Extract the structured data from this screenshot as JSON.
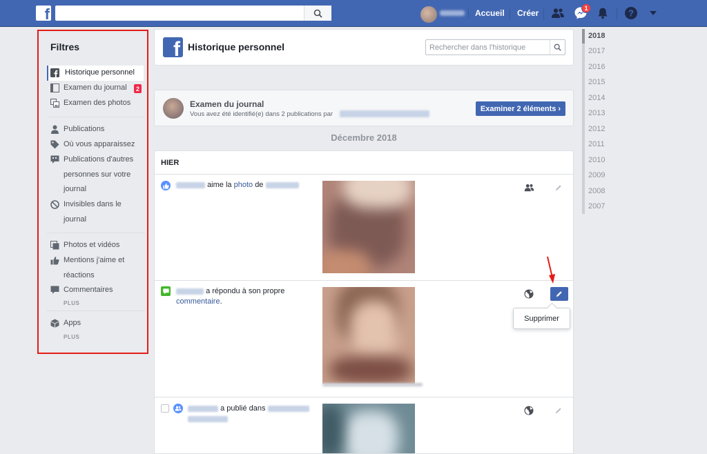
{
  "topbar": {
    "nav": [
      "Accueil",
      "Créer"
    ],
    "messenger_count": "1"
  },
  "filters": {
    "title": "Filtres",
    "items": [
      {
        "label": "Historique personnel",
        "icon": "facebook-square-icon",
        "active": true
      },
      {
        "label": "Examen du journal",
        "icon": "timeline-review-icon",
        "badge": "2"
      },
      {
        "label": "Examen des photos",
        "icon": "photo-review-icon"
      },
      {
        "label": "Publications",
        "icon": "person-icon"
      },
      {
        "label": "Où vous apparaissez",
        "icon": "tag-icon"
      },
      {
        "label": "Publications d'autres personnes sur votre journal",
        "icon": "speech-bubble-icon"
      },
      {
        "label": "Invisibles dans le journal",
        "icon": "hidden-icon"
      },
      {
        "label": "Photos et vidéos",
        "icon": "photos-icon"
      },
      {
        "label": "Mentions j'aime et réactions",
        "icon": "thumbs-up-icon"
      },
      {
        "label": "Commentaires",
        "icon": "comment-icon"
      },
      {
        "label": "Apps",
        "icon": "cube-icon"
      }
    ],
    "lines": {
      "others_1": "Publications d'autres",
      "others_2": "personnes sur votre",
      "others_3": "journal",
      "hidden_1": "Invisibles dans le",
      "hidden_2": "journal",
      "likes_1": "Mentions j'aime et",
      "likes_2": "réactions"
    },
    "more_label": "PLUS"
  },
  "header": {
    "title": "Historique personnel",
    "search_placeholder": "Rechercher dans l'historique"
  },
  "review": {
    "title": "Examen du journal",
    "description": "Vous avez été identifié(e) dans 2 publications par",
    "button": "Examiner 2 éléments ›"
  },
  "month": "Décembre 2018",
  "day": {
    "title": "HIER",
    "activities": [
      {
        "verb": "aime la",
        "link": "photo",
        "suffix": "de",
        "audience": "friends-icon"
      },
      {
        "verb": "a répondu à son propre",
        "link": "commentaire",
        "suffix": ".",
        "audience": "globe-icon"
      },
      {
        "verb": "a publié dans",
        "audience": "globe-icon"
      }
    ],
    "menu_item": "Supprimer"
  },
  "years": [
    "2018",
    "2017",
    "2016",
    "2015",
    "2014",
    "2013",
    "2012",
    "2011",
    "2010",
    "2009",
    "2008",
    "2007"
  ],
  "colors": {
    "brand": "#4267b2",
    "background": "#e9ebee",
    "highlight": "#e41b17",
    "badge": "#fa3e3e"
  }
}
